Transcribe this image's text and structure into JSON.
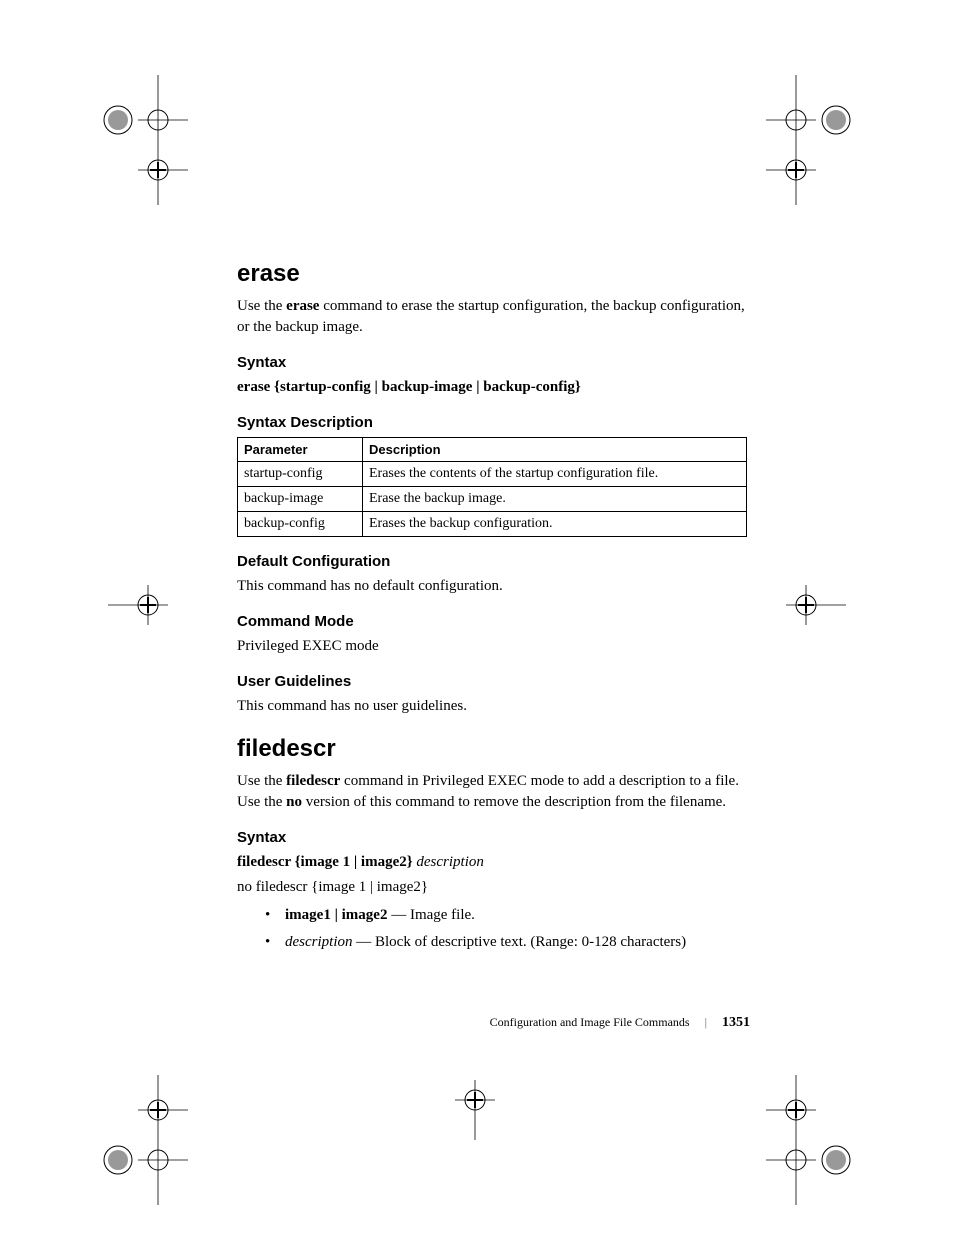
{
  "erase": {
    "title": "erase",
    "intro_pre": "Use the ",
    "intro_bold": "erase",
    "intro_post": " command to erase the startup configuration, the backup configuration, or the backup image.",
    "syntax_heading": "Syntax",
    "syntax_line": "erase {startup-config | backup-image | backup-config}",
    "syntax_desc_heading": "Syntax Description",
    "table_header_param": "Parameter",
    "table_header_desc": "Description",
    "rows": [
      {
        "param": "startup-config",
        "desc": "Erases the contents of the startup configuration file."
      },
      {
        "param": "backup-image",
        "desc": "Erase the backup image."
      },
      {
        "param": "backup-config",
        "desc": "Erases the backup configuration."
      }
    ],
    "default_heading": "Default Configuration",
    "default_text": "This command has no default configuration.",
    "mode_heading": "Command Mode",
    "mode_text": "Privileged EXEC mode",
    "guidelines_heading": "User Guidelines",
    "guidelines_text": "This command has no user guidelines."
  },
  "filedescr": {
    "title": "filedescr",
    "intro_pre": "Use the ",
    "intro_bold1": "filedescr",
    "intro_mid": " command in Privileged EXEC mode to add a description to a file. Use the ",
    "intro_bold2": "no",
    "intro_post": " version of this command to remove the description from the filename.",
    "syntax_heading": "Syntax",
    "syntax_bold": "filedescr {image 1 | image2} ",
    "syntax_italic": "description",
    "no_syntax": "no filedescr {image 1 | image2}",
    "bullets": [
      {
        "bold": "image1 | image2",
        "sep": " — ",
        "rest": " Image file."
      },
      {
        "italic": "description",
        "sep": " — ",
        "rest": "Block of descriptive text. (Range: 0-128 characters)"
      }
    ]
  },
  "footer": {
    "section": "Configuration and Image File Commands",
    "page": "1351"
  }
}
